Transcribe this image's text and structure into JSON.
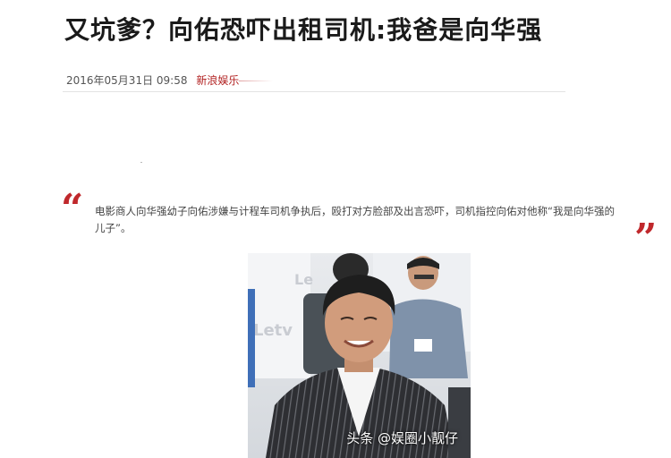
{
  "article": {
    "title": "又坑爹？向佑恐吓出租司机:我爸是向华强",
    "datetime": "2016年05月31日 09:58",
    "source": "新浪娱乐",
    "quote_open": "“",
    "quote_close": "”",
    "quote_text": "电影商人向华强幼子向佑涉嫌与计程车司机争执后，殴打对方脸部及出言恐吓，司机指控向佑对他称“我是向华强的儿子”。"
  },
  "watermark": "头条 @娱圈小靓仔",
  "colors": {
    "quote_mark": "#c0282c",
    "source_link": "#b22222",
    "title": "#1a1a1a"
  }
}
